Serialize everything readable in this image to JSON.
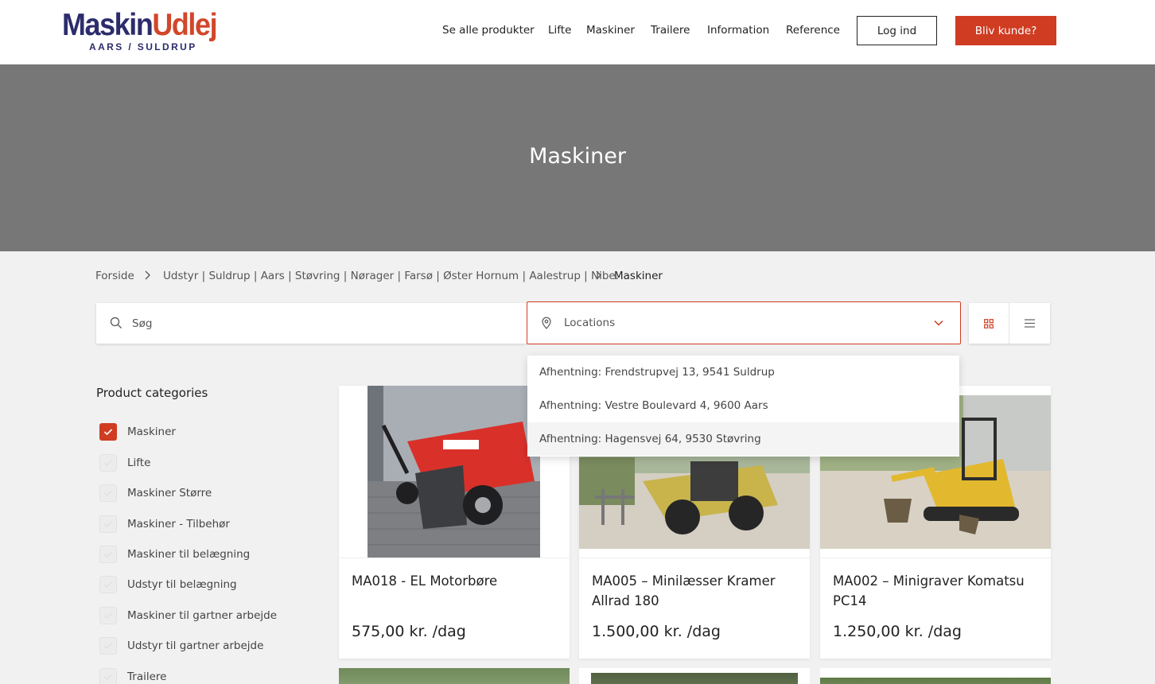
{
  "header": {
    "logo": {
      "main_part1": "Maskin",
      "main_part2": "Udlej",
      "sub": "AARS / SULDRUP"
    },
    "nav": [
      "Se alle produkter",
      "Lifte",
      "Maskiner",
      "Trailere",
      "Information",
      "Reference"
    ],
    "login_label": "Log ind",
    "signup_label": "Bliv kunde?"
  },
  "hero": {
    "title": "Maskiner"
  },
  "breadcrumb": {
    "items": [
      "Forside",
      "Udstyr | Suldrup | Aars | Støvring | Nørager | Farsø | Øster Hornum | Aalestrup | Nibe.",
      "Maskiner"
    ]
  },
  "search": {
    "placeholder": "Søg"
  },
  "location": {
    "placeholder": "Locations",
    "options": [
      "Afhentning: Frendstrupvej 13, 9541 Suldrup",
      "Afhentning: Vestre Boulevard 4, 9600 Aars",
      "Afhentning: Hagensvej 64, 9530 Støvring"
    ]
  },
  "sidebar": {
    "title": "Product categories",
    "categories": [
      {
        "label": "Maskiner",
        "checked": true
      },
      {
        "label": "Lifte",
        "checked": false
      },
      {
        "label": "Maskiner Større",
        "checked": false
      },
      {
        "label": "Maskiner - Tilbehør",
        "checked": false
      },
      {
        "label": "Maskiner til belægning",
        "checked": false
      },
      {
        "label": "Udstyr til belægning",
        "checked": false
      },
      {
        "label": "Maskiner til gartner arbejde",
        "checked": false
      },
      {
        "label": "Udstyr til gartner arbejde",
        "checked": false
      },
      {
        "label": "Trailere",
        "checked": false
      }
    ]
  },
  "products": [
    {
      "title": "MA018 - EL Motorbøre",
      "price": "575,00 kr. /dag"
    },
    {
      "title": "MA005 – Minilæsser Kramer Allrad 180",
      "price": "1.500,00 kr. /dag"
    },
    {
      "title": "MA002 – Minigraver Komatsu PC14",
      "price": "1.250,00 kr. /dag"
    }
  ],
  "colors": {
    "accent": "#cf3c22",
    "logo_blue": "#2c2c6c",
    "hero_bg": "#777777"
  }
}
